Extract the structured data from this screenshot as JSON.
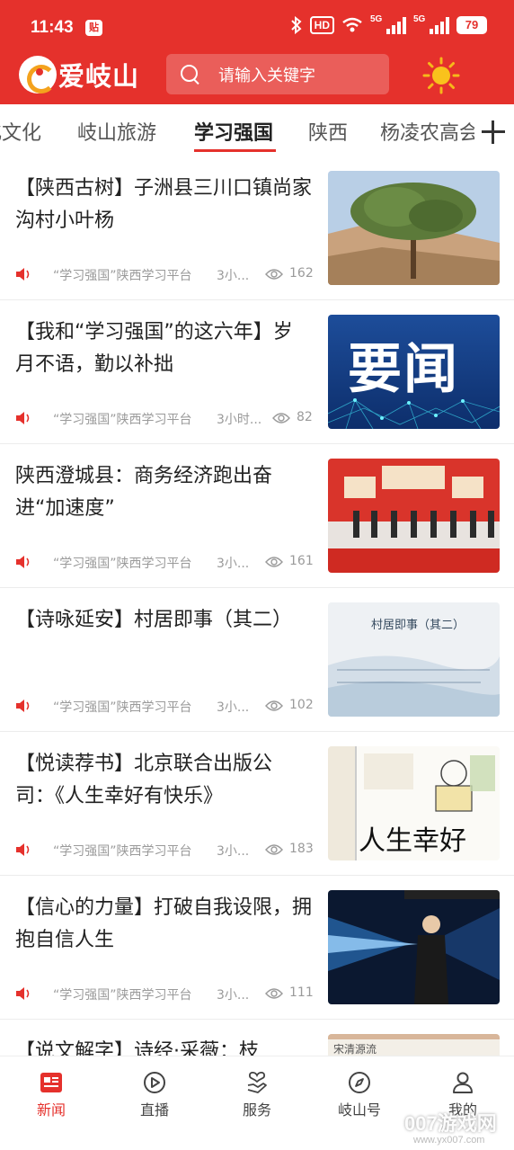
{
  "status_bar": {
    "time": "11:43",
    "notif_badge": "贴",
    "hd_label": "HD",
    "signal1_label": "5G",
    "signal2_label": "5G",
    "battery": "79"
  },
  "header": {
    "app_name": "爱岐山",
    "search_placeholder": "请输入关键字"
  },
  "tabs": [
    {
      "label": "化文化"
    },
    {
      "label": "岐山旅游"
    },
    {
      "label": "学习强国"
    },
    {
      "label": "陕西"
    },
    {
      "label": "杨凌农高会"
    }
  ],
  "articles": [
    {
      "title": "【陕西古树】子洲县三川口镇尚家沟村小叶杨",
      "source": "“学习强国”陕西学习平台",
      "time": "3小...",
      "views": "162",
      "thumb": "tree"
    },
    {
      "title": "【我和“学习强国”的这六年】岁月不语，勤以补拙",
      "source": "“学习强国”陕西学习平台",
      "time": "3小时...",
      "views": "82",
      "thumb": "yaowen",
      "thumb_text": "要闻"
    },
    {
      "title": "陕西澄城县：商务经济跑出奋进“加速度”",
      "source": "“学习强国”陕西学习平台",
      "time": "3小...",
      "views": "161",
      "thumb": "ceremony"
    },
    {
      "title": "【诗咏延安】村居即事（其二）",
      "source": "“学习强国”陕西学习平台",
      "time": "3小...",
      "views": "102",
      "thumb": "poem",
      "thumb_text": "村居即事（其二）"
    },
    {
      "title": "【悦读荐书】北京联合出版公司：《人生幸好有快乐》",
      "source": "“学习强国”陕西学习平台",
      "time": "3小...",
      "views": "183",
      "thumb": "book",
      "thumb_text": "人生幸好"
    },
    {
      "title": "【信心的力量】打破自我设限，拥抱自信人生",
      "source": "“学习强国”陕西学习平台",
      "time": "3小...",
      "views": "111",
      "thumb": "speaker"
    },
    {
      "title": "【说文解字】诗经·采薇：枝",
      "source": "",
      "time": "",
      "views": "",
      "thumb": "text",
      "thumb_text": "宋清源流"
    }
  ],
  "bottom_nav": [
    {
      "label": "新闻",
      "icon": "news-icon"
    },
    {
      "label": "直播",
      "icon": "play-icon"
    },
    {
      "label": "服务",
      "icon": "heart-hand-icon"
    },
    {
      "label": "岐山号",
      "icon": "compass-icon"
    },
    {
      "label": "我的",
      "icon": "user-icon"
    }
  ],
  "watermark": "007游戏网",
  "watermark_url": "www.yx007.com",
  "colors": {
    "brand_red": "#e5312c",
    "text": "#222222",
    "meta": "#9a9a9a"
  }
}
